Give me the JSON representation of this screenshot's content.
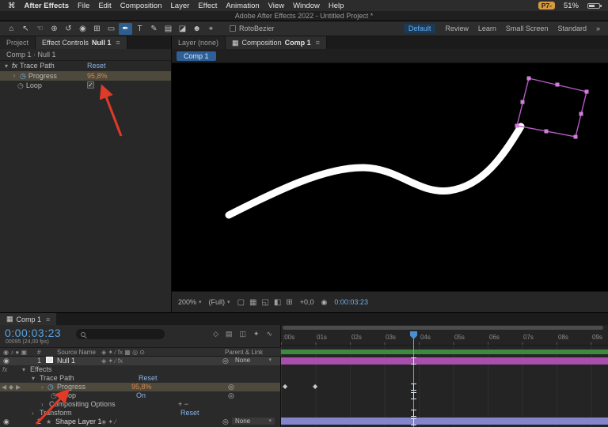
{
  "colors": {
    "accent_blue": "#4a90d0",
    "link_blue": "#8ab4e8",
    "value_orange": "#d3894e",
    "timecode_blue": "#5aa2e0",
    "cache_green": "#3f8a43",
    "layer_bar_magenta": "#a84fae",
    "layer_bar_lavender": "#8585cd",
    "annotation_red": "#e23a28",
    "workspace_active_blue": "#64aef0"
  },
  "icons": {
    "panel_menu": "≡",
    "overflow": "»",
    "twirl_open": "▾",
    "twirl_closed": "›",
    "chevron_down": "▾",
    "stopwatch": "◷",
    "watch_toggle": "◎",
    "pick_whip": "◎",
    "eye": "◉",
    "keyframe": "◆",
    "kf_prev": "◀",
    "kf_next": "▶",
    "star": "★",
    "check": "✓",
    "fx": "fx",
    "camera": "◉",
    "comp": "▦",
    "av_header": "◉ ♪ ● ▣",
    "switches_header": "◈ ✦ ∕ fx ▦ ◎ ⊙",
    "layer_switches_fx": "◈ ✦ ∕ fx",
    "layer_switches": "◈ ✦ ∕",
    "viewer_icons": [
      "▢",
      "▦",
      "◱",
      "◧",
      "⊞"
    ],
    "tl_view_icons": [
      "◇",
      "▤",
      "◫",
      "✦",
      "∿"
    ]
  },
  "menu_bar": {
    "apple_icon": "⌘",
    "items": [
      "After Effects",
      "File",
      "Edit",
      "Composition",
      "Layer",
      "Effect",
      "Animation",
      "View",
      "Window",
      "Help"
    ],
    "badge": "P7-",
    "battery": "51%"
  },
  "title_bar": {
    "title": "Adobe After Effects 2022 - Untitled Project *"
  },
  "toolbar": {
    "tools": [
      {
        "name": "home",
        "glyph": "⌂"
      },
      {
        "name": "selection",
        "glyph": "↖"
      },
      {
        "name": "hand",
        "glyph": "☜"
      },
      {
        "name": "zoom",
        "glyph": "⊕"
      },
      {
        "name": "rotation",
        "glyph": "↺"
      },
      {
        "name": "camera",
        "glyph": "◉"
      },
      {
        "name": "pan-behind",
        "glyph": "⊞"
      },
      {
        "name": "shape",
        "glyph": "▭"
      },
      {
        "name": "pen",
        "glyph": "✒"
      },
      {
        "name": "type",
        "glyph": "T"
      },
      {
        "name": "brush",
        "glyph": "✎"
      },
      {
        "name": "clone-stamp",
        "glyph": "▤"
      },
      {
        "name": "eraser",
        "glyph": "◪"
      },
      {
        "name": "roto-brush",
        "glyph": "☻"
      },
      {
        "name": "puppet",
        "glyph": "⌖"
      }
    ],
    "rotobezier_label": "RotoBezier",
    "workspaces": [
      "Default",
      "Review",
      "Learn",
      "Small Screen",
      "Standard"
    ]
  },
  "effect_controls": {
    "tab_project": "Project",
    "tab_label": "Effect Controls",
    "tab_target": "Null 1",
    "breadcrumb": "Comp 1 · Null 1",
    "effect": {
      "fx_badge": "fx",
      "name": "Trace Path",
      "reset": "Reset"
    },
    "progress_label": "Progress",
    "progress_value": "95,8%",
    "loop_label": "Loop"
  },
  "viewer": {
    "tab_layer": "Layer (none)",
    "tab_comp_label": "Composition",
    "tab_comp_name": "Comp 1",
    "comp_chip": "Comp 1",
    "zoom_value": "200%",
    "resolution_value": "(Full)",
    "mouse_offset": "+0,0",
    "timecode": "0:00:03:23"
  },
  "timeline": {
    "tab_name": "Comp 1",
    "timecode": "0:00:03:23",
    "frame_info": "00095 (24,00 fps)",
    "ruler_labels": [
      ":00s",
      "01s",
      "02s",
      "03s",
      "04s",
      "05s",
      "06s",
      "07s",
      "08s",
      "09s"
    ],
    "header": {
      "index": "#",
      "source_name": "Source Name",
      "parent_link": "Parent & Link"
    },
    "layer1": {
      "index": "1",
      "name": "Null 1",
      "parent": "None"
    },
    "effects_group": "Effects",
    "trace_path": {
      "name": "Trace Path",
      "reset": "Reset"
    },
    "progress": {
      "name": "Progress",
      "value": "95,8%"
    },
    "loop": {
      "name": "Loop",
      "value": "On"
    },
    "compositing": {
      "name": "Compositing Options",
      "value": "+ −"
    },
    "transform": {
      "name": "Transform",
      "reset": "Reset"
    },
    "layer2": {
      "index": "2",
      "name": "Shape Layer 1",
      "parent": "None"
    }
  }
}
